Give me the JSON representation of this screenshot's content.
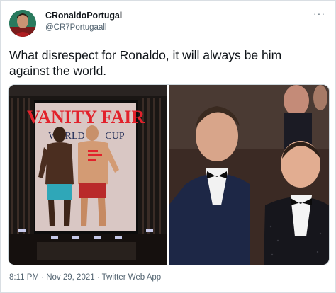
{
  "tweet": {
    "display_name": "CRonaldoPortugal",
    "handle": "@CR7Portugaall",
    "more_icon": "more-horizontal-icon",
    "text_line1": "What disrespect for Ronaldo, it will always be him",
    "text_line2": "against the world.",
    "time": "8:11 PM",
    "separator": " · ",
    "date": "Nov 29, 2021",
    "source": "Twitter Web App"
  },
  "media": {
    "left_image": {
      "magazine_title": "VANITY FAIR",
      "cover_line1": "WORLD",
      "cover_line2": "CUP"
    }
  },
  "colors": {
    "text_primary": "#0f1419",
    "text_secondary": "#536471",
    "border": "#cfd9de"
  }
}
